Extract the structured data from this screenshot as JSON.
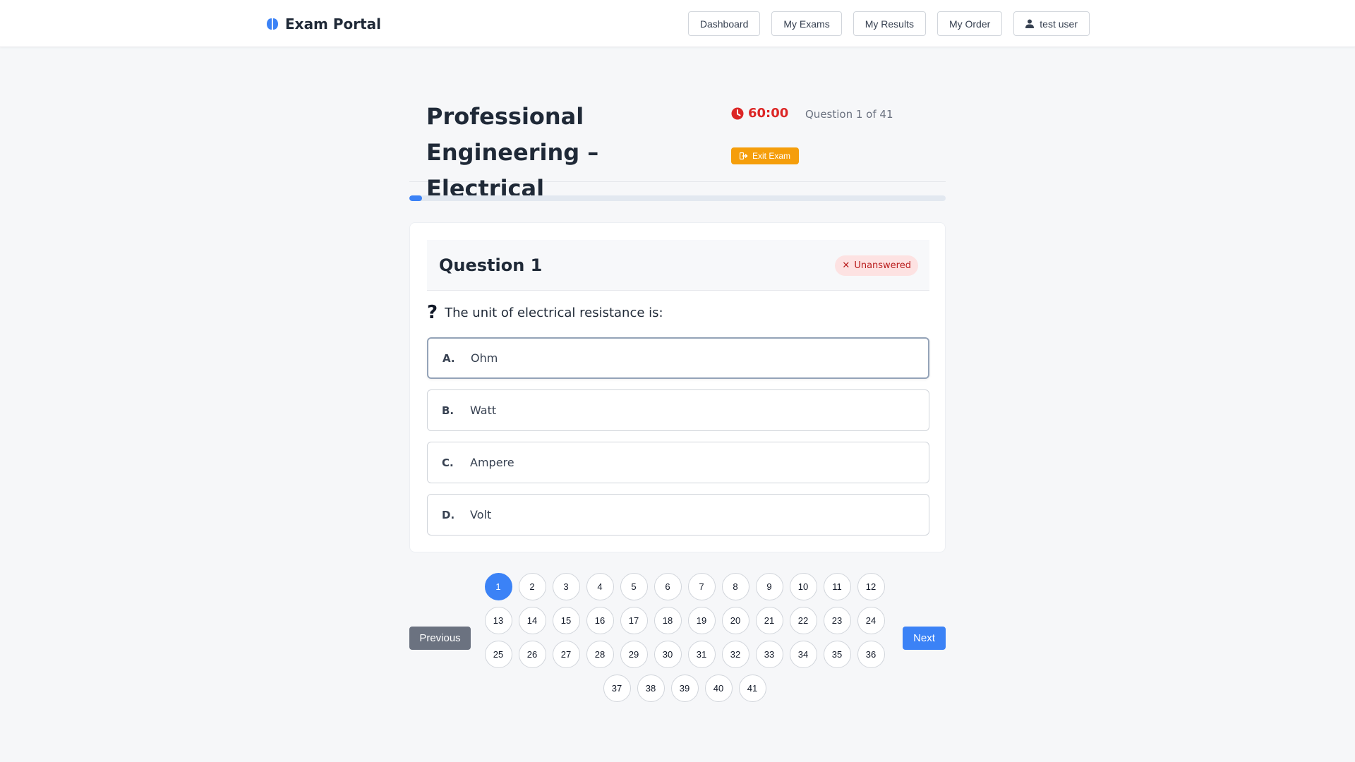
{
  "brand": {
    "name": "Exam Portal",
    "icon": "brain-icon",
    "color": "#3b82f6"
  },
  "nav": {
    "items": [
      {
        "label": "Dashboard"
      },
      {
        "label": "My Exams"
      },
      {
        "label": "My Results"
      },
      {
        "label": "My Order"
      }
    ],
    "user": {
      "label": "test user",
      "icon": "user-icon"
    }
  },
  "exam": {
    "title": "Professional Engineering – Electrical",
    "timer": "60:00",
    "timer_icon": "clock-icon",
    "timer_color": "#dc2626",
    "question_counter": "Question 1 of 41",
    "exit_label": "Exit Exam",
    "exit_color": "#f59e0b",
    "progress_fraction": 0.024
  },
  "question": {
    "title": "Question 1",
    "status": "Unanswered",
    "status_icon": "x-icon",
    "text": "The unit of electrical resistance is:",
    "text_icon": "question-mark-icon",
    "options": [
      {
        "letter": "A.",
        "text": "Ohm"
      },
      {
        "letter": "B.",
        "text": "Watt"
      },
      {
        "letter": "C.",
        "text": "Ampere"
      },
      {
        "letter": "D.",
        "text": "Volt"
      }
    ]
  },
  "navigation": {
    "previous_label": "Previous",
    "next_label": "Next",
    "current": 1,
    "question_numbers": [
      "1",
      "2",
      "3",
      "4",
      "5",
      "6",
      "7",
      "8",
      "9",
      "10",
      "11",
      "12",
      "13",
      "14",
      "15",
      "16",
      "17",
      "18",
      "19",
      "20",
      "21",
      "22",
      "23",
      "24",
      "25",
      "26",
      "27",
      "28",
      "29",
      "30",
      "31",
      "32",
      "33",
      "34",
      "35",
      "36",
      "37",
      "38",
      "39",
      "40",
      "41"
    ]
  }
}
